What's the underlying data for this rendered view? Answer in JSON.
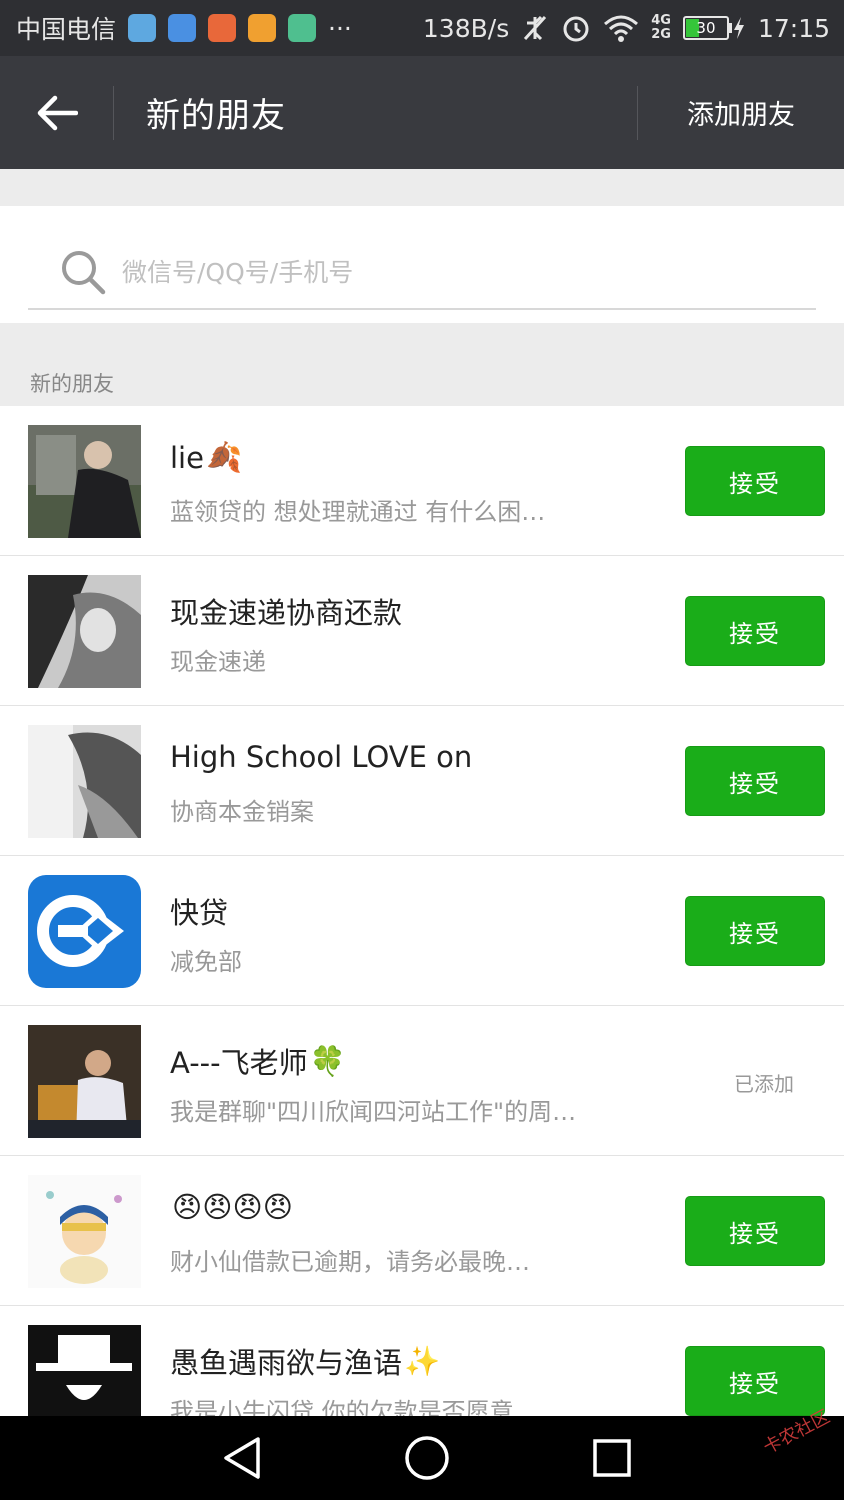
{
  "status_bar": {
    "carrier": "中国电信",
    "more": "···",
    "net_speed": "138B/s",
    "network_top": "4G",
    "network_bottom": "2G",
    "battery": "30",
    "battery_level": 0.3,
    "time": "17:15"
  },
  "toolbar": {
    "title": "新的朋友",
    "add_friend_label": "添加朋友"
  },
  "search": {
    "placeholder": "微信号/QQ号/手机号"
  },
  "section": {
    "title": "新的朋友"
  },
  "requests": [
    {
      "name": "lie",
      "emoji": "🍂",
      "message": "蓝领贷的 想处理就通过 有什么困…",
      "action": "接受"
    },
    {
      "name": "现金速递协商还款",
      "emoji": "",
      "message": "现金速递",
      "action": "接受"
    },
    {
      "name": "High School LOVE on",
      "emoji": "",
      "message": "协商本金销案",
      "action": "接受"
    },
    {
      "name": "快贷",
      "emoji": "",
      "message": "减免部",
      "action": "接受"
    },
    {
      "name": "A---飞老师",
      "emoji": "🍀",
      "message": "我是群聊\"四川欣闻四河站工作\"的周…",
      "status": "已添加"
    },
    {
      "name": "",
      "emoji": "😠😠😠😠",
      "message": "财小仙借款已逾期，请务必最晚…",
      "action": "接受"
    },
    {
      "name": "愚鱼遇雨欲与渔语",
      "emoji": "✨",
      "message": "我是小牛闪贷 你的欠款是否愿意…",
      "action": "接受"
    }
  ],
  "watermark": "卡农社区",
  "colors": {
    "accent": "#1aad19",
    "toolbar": "#393a3f",
    "statusbar": "#2e2f33"
  }
}
